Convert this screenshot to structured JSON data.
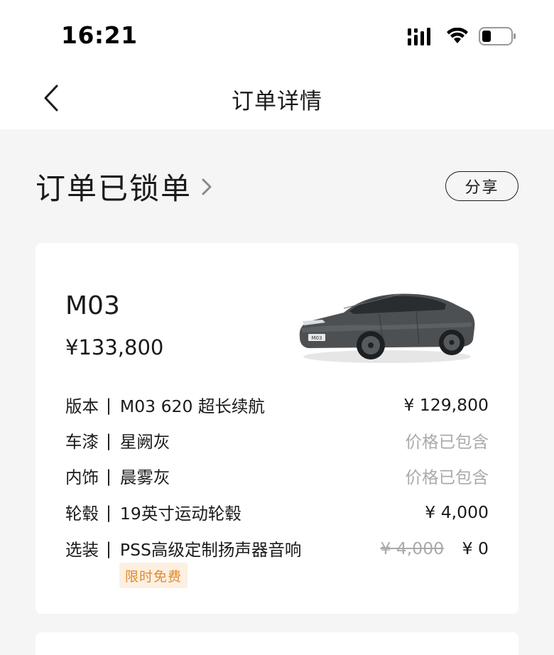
{
  "status_bar": {
    "time": "16:21"
  },
  "nav": {
    "title": "订单详情"
  },
  "order": {
    "status_text": "订单已锁单",
    "share_label": "分享"
  },
  "product": {
    "model": "M03",
    "total_price": "¥133,800"
  },
  "config_items": [
    {
      "category": "版本",
      "separator": "|",
      "name": "M03 620 超长续航",
      "price": "¥ 129,800"
    },
    {
      "category": "车漆",
      "separator": "|",
      "name": "星阙灰",
      "price": "价格已包含"
    },
    {
      "category": "内饰",
      "separator": "|",
      "name": "晨雾灰",
      "price": "价格已包含"
    },
    {
      "category": "轮毂",
      "separator": "|",
      "name": "19英寸运动轮毂",
      "price": "¥ 4,000"
    },
    {
      "category": "选装",
      "separator": "|",
      "name": "PSS高级定制扬声器音响",
      "original_price": "¥ 4,000",
      "price": "¥ 0",
      "badge": "限时免费"
    }
  ],
  "colors": {
    "accent_badge": "#e08a2e",
    "badge_bg": "#fdf0e2",
    "muted": "#aaaaaa"
  },
  "icons": [
    "signal-icon",
    "wifi-icon",
    "battery-icon",
    "back-arrow-icon",
    "chevron-right-icon"
  ],
  "car_plate_text": "M03"
}
